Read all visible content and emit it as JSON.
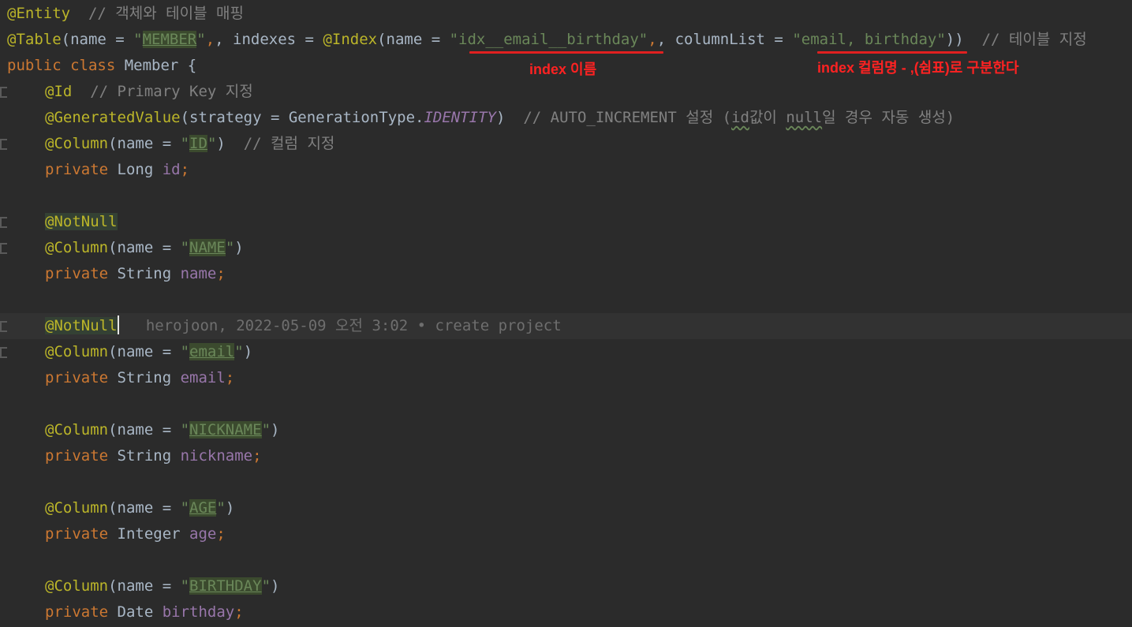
{
  "colors": {
    "background": "#2b2b2b",
    "annotation": "#bbb529",
    "keyword": "#cc7832",
    "string": "#6a8759",
    "comment": "#808080",
    "field": "#9876aa",
    "callout_red": "#ff2222"
  },
  "code": {
    "l1": {
      "annotation": "@Entity",
      "comment": "// 객체와 테이블 매핑"
    },
    "l2": {
      "annotation": "@Table",
      "p1": "(name = ",
      "q": "\"",
      "table_name": "MEMBER",
      "p2": ", indexes = ",
      "index_annotation": "@Index",
      "p3": "(name = ",
      "index_name": "\"idx__email__birthday\"",
      "p4": ", columnList = ",
      "column_list": "\"email, birthday\"",
      "p5": "))",
      "comment": "// 테이블 지정"
    },
    "l3": {
      "kw_public": "public",
      "kw_class": "class",
      "rest": " Member {"
    },
    "l4": {
      "annotation": "@Id",
      "comment": "// Primary Key 지정"
    },
    "l5": {
      "annotation": "@GeneratedValue",
      "p1": "(strategy = GenerationType.",
      "constant": "IDENTITY",
      "p2": ")",
      "comment_a": "// AUTO_INCREMENT 설정 (",
      "comment_id": "id",
      "comment_b": "값이 ",
      "comment_null": "null",
      "comment_c": "일 경우 자동 생성)"
    },
    "l6": {
      "annotation": "@Column",
      "p1": "(name = ",
      "q": "\"",
      "value": "ID",
      "p2": ")",
      "comment": "// 컬럼 지정"
    },
    "l7": {
      "kw": "private",
      "type": " Long ",
      "field": "id",
      "semi": ";"
    },
    "l9": {
      "annotation": "@NotNull"
    },
    "l10": {
      "annotation": "@Column",
      "p1": "(name = ",
      "q": "\"",
      "value": "NAME",
      "p2": ")"
    },
    "l11": {
      "kw": "private",
      "type": " String ",
      "field": "name",
      "semi": ";"
    },
    "l13": {
      "annotation": "@NotNull",
      "blame": "herojoon, 2022-05-09 오전 3:02 • create project"
    },
    "l14": {
      "annotation": "@Column",
      "p1": "(name = ",
      "q": "\"",
      "value": "email",
      "p2": ")"
    },
    "l15": {
      "kw": "private",
      "type": " String ",
      "field": "email",
      "semi": ";"
    },
    "l17": {
      "annotation": "@Column",
      "p1": "(name = ",
      "q": "\"",
      "value": "NICKNAME",
      "p2": ")"
    },
    "l18": {
      "kw": "private",
      "type": " String ",
      "field": "nickname",
      "semi": ";"
    },
    "l20": {
      "annotation": "@Column",
      "p1": "(name = ",
      "q": "\"",
      "value": "AGE",
      "p2": ")"
    },
    "l21": {
      "kw": "private",
      "type": " Integer ",
      "field": "age",
      "semi": ";"
    },
    "l23": {
      "annotation": "@Column",
      "p1": "(name = ",
      "q": "\"",
      "value": "BIRTHDAY",
      "p2": ")"
    },
    "l24": {
      "kw": "private",
      "type": " Date ",
      "field": "birthday",
      "semi": ";"
    }
  },
  "callouts": {
    "index_name": "index 이름",
    "index_columns": "index 컬럼명 - ,(쉼표)로 구분한다"
  }
}
